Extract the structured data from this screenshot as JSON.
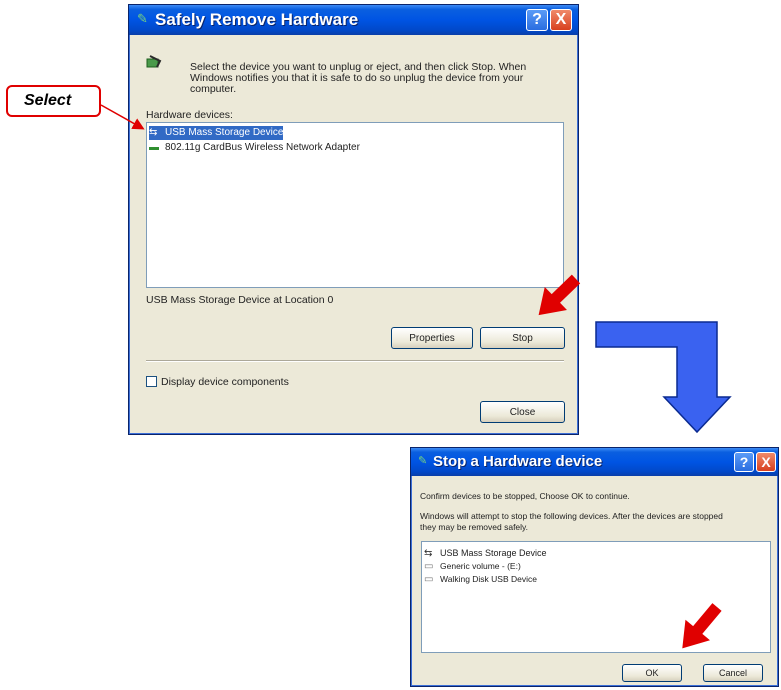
{
  "callout": {
    "label": "Select"
  },
  "dialog1": {
    "title": "Safely Remove Hardware",
    "instruction_line1": "Select the device you want to unplug or eject, and then click Stop. When",
    "instruction_line2": "Windows notifies you that it is safe to do so unplug the device from your",
    "instruction_line3": "computer.",
    "list_label": "Hardware devices:",
    "devices": [
      {
        "label": "USB Mass Storage Device",
        "icon": "usb-icon",
        "selected": true
      },
      {
        "label": "802.11g CardBus Wireless Network Adapter",
        "icon": "network-card-icon",
        "selected": false
      }
    ],
    "status": "USB Mass Storage Device at Location 0",
    "properties_label": "Properties",
    "stop_label": "Stop",
    "checkbox_label": "Display device components",
    "close_label": "Close",
    "help_glyph": "?",
    "close_glyph": "X"
  },
  "dialog2": {
    "title": "Stop a Hardware device",
    "confirm": "Confirm devices to be stopped, Choose OK to continue.",
    "warn_line1": "Windows will attempt to stop the following devices. After the devices are stopped",
    "warn_line2": "they may be removed safely.",
    "devices": [
      {
        "label": "USB Mass Storage Device",
        "icon": "usb-icon"
      },
      {
        "label": "Generic volume - (E:)",
        "icon": "drive-icon"
      },
      {
        "label": "Walking Disk USB Device",
        "icon": "drive-icon"
      }
    ],
    "ok_label": "OK",
    "cancel_label": "Cancel",
    "help_glyph": "?",
    "close_glyph": "X"
  },
  "colors": {
    "accent_red": "#e00000",
    "flow_arrow_blue": "#3a62f0",
    "titlebar_blue": "#0054e3",
    "selection": "#316ac5"
  }
}
